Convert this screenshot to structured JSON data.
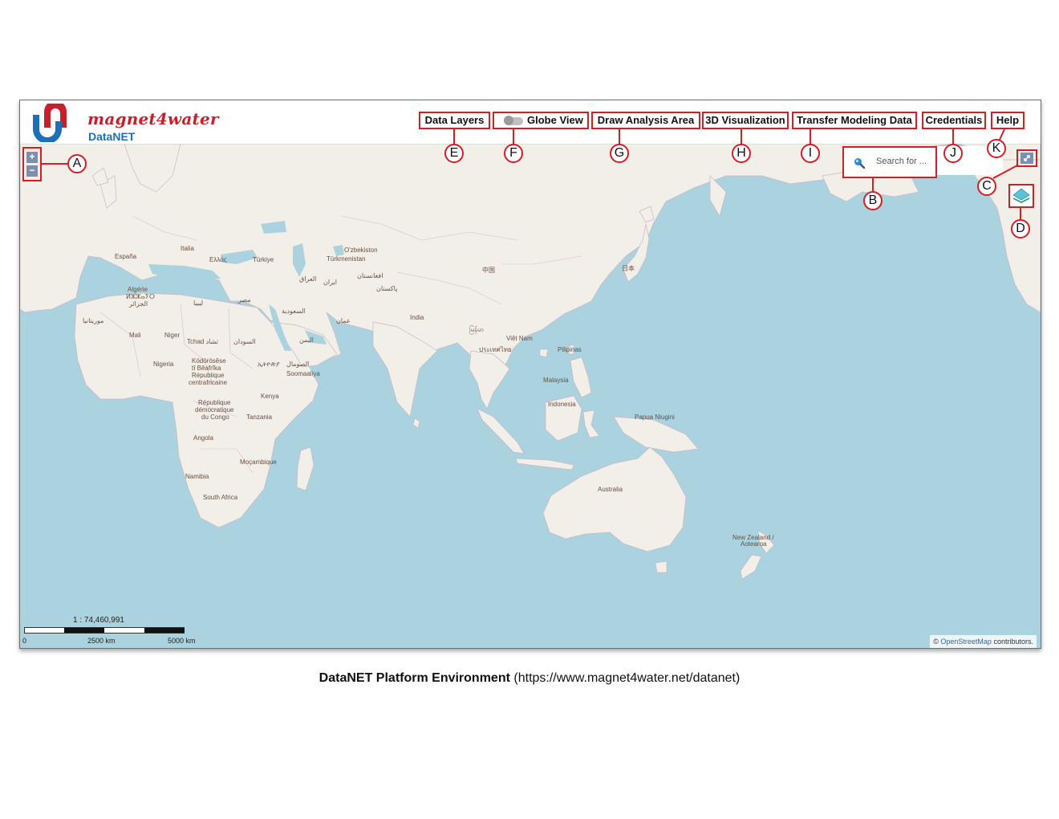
{
  "brand": {
    "name": "magnet4water",
    "product": "DataNET",
    "primary_color": "#c8202a",
    "accent_color": "#1d6fb8"
  },
  "nav": {
    "data_layers": "Data Layers",
    "globe_view": "Globe View",
    "draw_analysis": "Draw Analysis Area",
    "visualization_3d": "3D Visualization",
    "transfer_modeling": "Transfer Modeling Data",
    "credentials": "Credentials",
    "help": "Help"
  },
  "map": {
    "zoom_in": "+",
    "zoom_out": "−",
    "search_placeholder": "Search for ...",
    "scale_ratio": "1 : 74,460,991",
    "scale_ticks": [
      "0",
      "2500 km",
      "5000 km"
    ],
    "attribution_prefix": "©",
    "attribution_link": "OpenStreetMap",
    "attribution_suffix": "contributors.",
    "ocean_color": "#aad3df",
    "land_color": "#f2efe9",
    "labels": {
      "espana": "España",
      "italia": "Italia",
      "ellas": "Ελλάς",
      "turkiye": "Türkiye",
      "ozbekiston": "O'zbekiston",
      "turkmenistan": "Türkmenistan",
      "algerie": "Algérie",
      "algerie_ar": "ⵍⵣⵣⴰⵢⵔ",
      "algerie_ar2": "الجزائر",
      "libya": "ليبيا",
      "misr": "مصر",
      "iraq": "العراق",
      "iran": "ایران",
      "afghanistan": "افغانستان",
      "pakistan": "پاکستان",
      "saudi": "السعودية",
      "oman": "عمان",
      "yemen": "اليمن",
      "mauritania": "موريتانيا",
      "mali": "Mali",
      "niger": "Niger",
      "tchad": "Tchad تشاد",
      "sudan": "السودان",
      "ethiopia": "ኢትዮጵያ",
      "somalia_ar": "الصومال",
      "somalia": "Soomaaliya",
      "nigeria": "Nigeria",
      "car1": "Ködörösêse",
      "car2": "tî Bêafrîka",
      "car3": "République",
      "car4": "centrafricaine",
      "kenya": "Kenya",
      "drc1": "République",
      "drc2": "démocratique",
      "drc3": "du Congo",
      "tanzania": "Tanzania",
      "angola": "Angola",
      "mocambique": "Moçambique",
      "namibia": "Namibia",
      "south_africa": "South Africa",
      "india": "India",
      "china": "中国",
      "japan": "日本",
      "myanmar": "မြန်မာ",
      "thailand": "ประเทศไทย",
      "vietnam": "Việt Nam",
      "pilipinas": "Pilipinas",
      "malaysia": "Malaysia",
      "indonesia": "Indonesia",
      "png": "Papua Niugini",
      "australia": "Australia",
      "nz1": "New Zealand /",
      "nz2": "Aotearoa"
    }
  },
  "callouts": [
    "A",
    "B",
    "C",
    "D",
    "E",
    "F",
    "G",
    "H",
    "I",
    "J",
    "K"
  ],
  "caption": {
    "bold": "DataNET Platform Environment",
    "url": "(https://www.magnet4water.net/datanet)"
  },
  "annotation_color": "#d41d24"
}
